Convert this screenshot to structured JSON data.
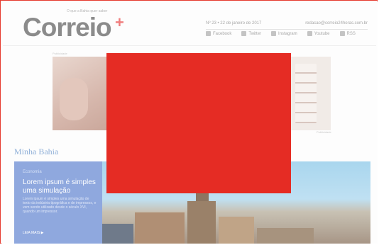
{
  "header": {
    "logo_text": "Correio",
    "logo_plus": "+",
    "logo_tagline": "O que a Bahia quer saber",
    "date": "Nº 23 • 22 de janeiro de 2017",
    "email": "redacao@correio24horas.com.br",
    "social": [
      {
        "label": "Facebook",
        "icon": "facebook-icon"
      },
      {
        "label": "Twitter",
        "icon": "twitter-icon"
      },
      {
        "label": "Instagram",
        "icon": "instagram-icon"
      },
      {
        "label": "Youtube",
        "icon": "youtube-icon"
      },
      {
        "label": "RSS",
        "icon": "rss-icon"
      }
    ]
  },
  "ad": {
    "label": "Publicidade",
    "footer": "Publicidade"
  },
  "section": {
    "title": "Minha Bahia"
  },
  "feature": {
    "eyebrow": "Economia",
    "headline": "Lorem ipsum é simples uma simulação",
    "blurb": "Lorem ipsum é simples uma simulação de texto da indústria tipográfica e de impressos, e vem sendo utilizado desde o século XVI, quando um impressor.",
    "readmore": "LEIA MAIS ▶"
  },
  "colors": {
    "accent": "#e52c24",
    "section_title": "#90b0d8",
    "card_bg": "#8fa8de"
  }
}
